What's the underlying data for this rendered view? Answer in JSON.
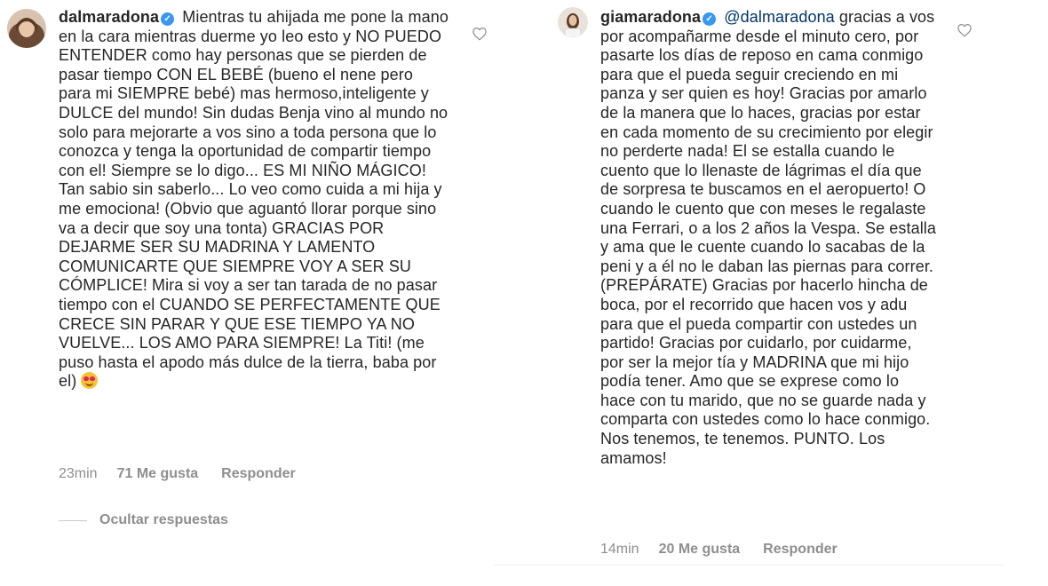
{
  "left_comment": {
    "username": "dalmaradona",
    "text": "Mientras tu ahijada me pone la mano en la cara mientras duerme yo leo esto y NO PUEDO ENTENDER como hay personas que se pierden de pasar tiempo CON EL BEBÉ (bueno el nene pero para mi SIEMPRE bebé) mas hermoso,inteligente y DULCE del mundo! Sin dudas Benja vino al mundo no solo para mejorarte a vos sino a toda persona que lo conozca y tenga la oportunidad de compartir tiempo con el! Siempre se lo digo... ES MI NIÑO MÁGICO! Tan sabio sin saberlo... Lo veo como cuida a mi hija y me emociona! (Obvio que aguantó llorar porque sino va a decir que soy una tonta) GRACIAS POR DEJARME SER SU MADRINA Y LAMENTO COMUNICARTE QUE SIEMPRE VOY A SER SU CÓMPLICE! Mira si voy a ser tan tarada de no pasar tiempo con el CUANDO SE PERFECTAMENTE QUE CRECE SIN PARAR Y QUE ESE TIEMPO YA NO VUELVE... LOS AMO PARA SIEMPRE! La Titi! (me puso hasta el apodo más dulce de la tierra, baba por el)",
    "emoji": "heart-eyes-emoji",
    "time": "23min",
    "likes": "71 Me gusta",
    "reply": "Responder",
    "hide_replies": "Ocultar respuestas"
  },
  "right_comment": {
    "username": "giamaradona",
    "mention": "@dalmaradona",
    "text": "gracias a vos por acompañarme desde el minuto cero, por pasarte los días de reposo en cama conmigo para que el pueda seguir creciendo en mi panza y ser quien es hoy! Gracias por amarlo de la manera que lo haces, gracias por estar en cada momento de su crecimiento por elegir no perderte nada! El se estalla cuando le cuento que lo llenaste de lágrimas el día que de sorpresa te buscamos en el aeropuerto! O cuando le cuento que con meses le regalaste una Ferrari, o a los 2 años la Vespa. Se estalla y ama que le cuente cuando lo sacabas de la peni y a él no le daban las piernas para correr. (PREPÁRATE) Gracias por hacerlo hincha de boca, por el recorrido que hacen vos y adu para que el pueda compartir con ustedes un partido! Gracias por cuidarlo, por cuidarme, por ser la mejor tía y MADRINA que mi hijo podía tener. Amo que se exprese como lo hace con tu marido, que no se guarde nada y comparta con ustedes como lo hace conmigo. Nos tenemos, te tenemos. PUNTO. Los amamos!",
    "time": "14min",
    "likes": "20 Me gusta",
    "reply": "Responder"
  },
  "colors": {
    "text": "#262626",
    "secondary": "#8e8e8e",
    "verified": "#3897f0",
    "mention": "#003569"
  }
}
